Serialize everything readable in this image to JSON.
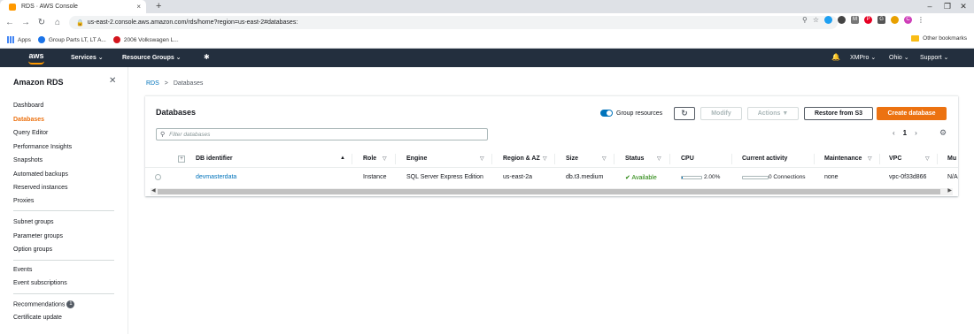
{
  "browser": {
    "tab_title": "RDS · AWS Console",
    "tab_close": "×",
    "new_tab": "+",
    "window_controls": [
      "–",
      "❐",
      "✕"
    ],
    "url": "us-east-2.console.aws.amazon.com/rds/home?region=us-east-2#databases:",
    "bookmarks": [
      "Apps",
      "Group Parts LT, LT A...",
      "2006 Volkswagen L..."
    ],
    "other_bookmarks": "Other bookmarks"
  },
  "aws_nav": {
    "logo": "aws",
    "services": "Services ⌄",
    "resource_groups": "Resource Groups ⌄",
    "account": "XMPro ⌄",
    "region": "Ohio ⌄",
    "support": "Support ⌄"
  },
  "sidebar": {
    "title": "Amazon RDS",
    "group1": [
      "Dashboard",
      "Databases",
      "Query Editor",
      "Performance Insights",
      "Snapshots",
      "Automated backups",
      "Reserved instances",
      "Proxies"
    ],
    "group2": [
      "Subnet groups",
      "Parameter groups",
      "Option groups"
    ],
    "group3": [
      "Events",
      "Event subscriptions"
    ],
    "group4": [
      "Recommendations",
      "Certificate update"
    ],
    "recommendations_badge": "1",
    "active": "Databases"
  },
  "breadcrumb": {
    "root": "RDS",
    "separator": ">",
    "current": "Databases"
  },
  "panel": {
    "title": "Databases",
    "group_resources": "Group resources",
    "refresh": "↻",
    "modify": "Modify",
    "actions": "Actions ▼",
    "restore": "Restore from S3",
    "create": "Create database",
    "filter_placeholder": "Filter databases",
    "page": "1"
  },
  "table": {
    "columns": [
      "DB identifier",
      "Role",
      "Engine",
      "Region & AZ",
      "Size",
      "Status",
      "CPU",
      "Current activity",
      "Maintenance",
      "VPC",
      "Mu"
    ],
    "row": {
      "identifier": "devmasterdata",
      "role": "Instance",
      "engine": "SQL Server Express Edition",
      "region_az": "us-east-2a",
      "size": "db.t3.medium",
      "status": "Available",
      "cpu": "2.00%",
      "cpu_fraction": 0.02,
      "activity": "0 Connections",
      "maintenance": "none",
      "vpc": "vpc-0f33d866",
      "multi_az": "N/A"
    }
  },
  "colors": {
    "aws_nav_bg": "#232f3e",
    "accent_orange": "#ec7211",
    "link_blue": "#0073bb",
    "status_green": "#1d8102"
  }
}
